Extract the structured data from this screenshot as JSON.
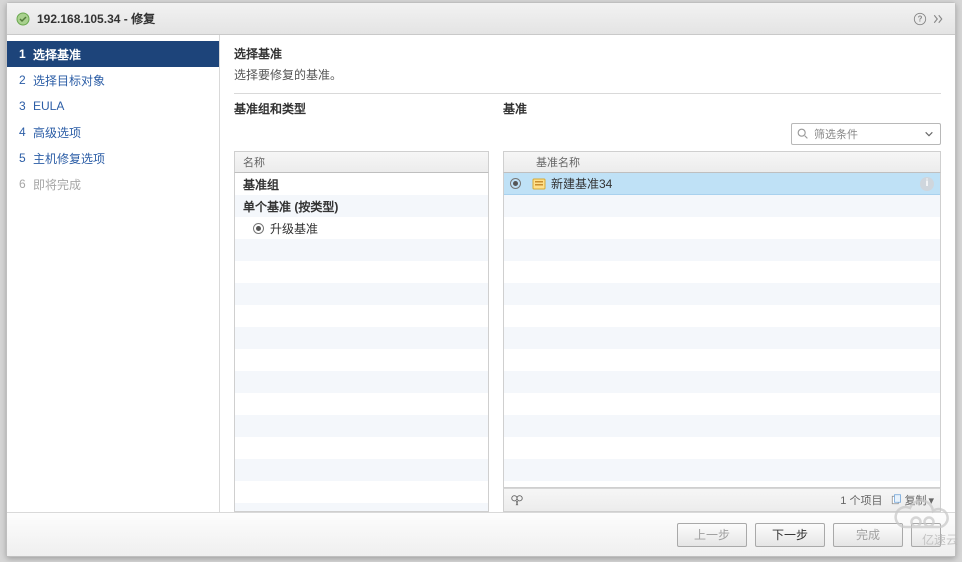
{
  "window": {
    "title": "192.168.105.34 - 修复"
  },
  "steps": [
    {
      "num": "1",
      "label": "选择基准",
      "state": "active"
    },
    {
      "num": "2",
      "label": "选择目标对象",
      "state": "link"
    },
    {
      "num": "3",
      "label": "EULA",
      "state": "link"
    },
    {
      "num": "4",
      "label": "高级选项",
      "state": "link"
    },
    {
      "num": "5",
      "label": "主机修复选项",
      "state": "link"
    },
    {
      "num": "6",
      "label": "即将完成",
      "state": "disabled"
    }
  ],
  "page": {
    "title": "选择基准",
    "desc": "选择要修复的基准。"
  },
  "left_panel": {
    "title": "基准组和类型",
    "column_header": "名称",
    "rows": [
      {
        "label": "基准组",
        "bold": true,
        "radio": false,
        "indent": 0
      },
      {
        "label": "单个基准 (按类型)",
        "bold": true,
        "radio": false,
        "indent": 0
      },
      {
        "label": "升级基准",
        "bold": false,
        "radio": true,
        "selected": true,
        "indent": 1
      }
    ]
  },
  "right_panel": {
    "title": "基准",
    "filter_placeholder": "筛选条件",
    "column_header": "基准名称",
    "rows": [
      {
        "label": "新建基准34",
        "selected": true
      }
    ],
    "footer": {
      "count_label": "1 个项目",
      "copy_label": "复制"
    }
  },
  "buttons": {
    "back": "上一步",
    "next": "下一步",
    "finish": "完成"
  },
  "watermark": {
    "text": "亿速云"
  }
}
